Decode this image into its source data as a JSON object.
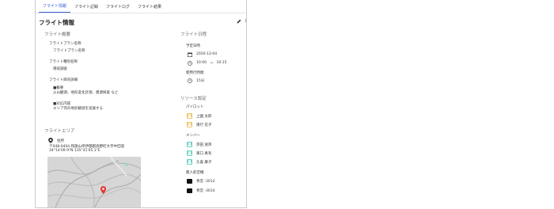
{
  "tabs": [
    {
      "label": "フライト情報",
      "active": true
    },
    {
      "label": "フライト記録",
      "active": false
    },
    {
      "label": "フライトログ",
      "active": false
    },
    {
      "label": "フライト結果",
      "active": false
    }
  ],
  "page_title": "フライト情報",
  "edit_label": "編",
  "overview": {
    "heading": "フライト概要",
    "plan_name_label": "フライトプラン名称",
    "plan_name_value": "フライトプラン名称",
    "type_label": "フライト種別名称",
    "type_value": "南岐調査",
    "purpose_label": "フライト目的詳細",
    "purpose_line1": "■概要",
    "purpose_line2": "火山観測、地形変化計測、資源探査 など",
    "purpose_line3": "■対応内容",
    "purpose_line4": "エリア内の地形観測を実施する"
  },
  "area": {
    "heading": "フライトエリア",
    "address_label": "住所",
    "address_line1": "〒048-0404 和歌山県伊都郡高野町大字中団道",
    "address_line2": "34°14'09.9\"N 135°41'05.1\"E"
  },
  "schedule": {
    "heading": "フライト日程",
    "date_label": "予定日時",
    "date_value": "2020-12-04",
    "time_start": "10:00",
    "time_sep": "〜",
    "time_end": "10:15",
    "duration_label": "使用行時間",
    "duration_value": "15分"
  },
  "resources": {
    "heading": "リソース設定",
    "pilot_label": "パイロット",
    "pilots": [
      "上國 太郎",
      "南行 花子"
    ],
    "member_label": "メンバー",
    "members": [
      "宗田 遠邦",
      "東口 真有",
      "久喜 康子"
    ],
    "drone_label": "無人航空機",
    "drones": [
      "青宮 -3012",
      "青宮 -3014"
    ]
  },
  "colors": {
    "accent": "#3b5bd6",
    "marker": "#e53935",
    "pilot_icon": "#f0c36b",
    "member_icon": "#6fd3c6"
  }
}
